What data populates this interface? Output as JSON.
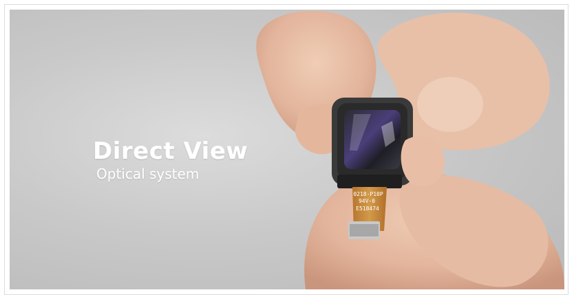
{
  "video": {
    "caption_title": "Direct View",
    "caption_subtitle": "Optical system",
    "flex_cable_markings": [
      "0218-P10P",
      "94V-0",
      "E518474"
    ]
  },
  "colors": {
    "background": "#c9c9c9",
    "skin": "#e2b8a0",
    "module_body": "#3a3a3a",
    "flex_cable": "#c98a3a",
    "caption_text": "#ffffff"
  }
}
